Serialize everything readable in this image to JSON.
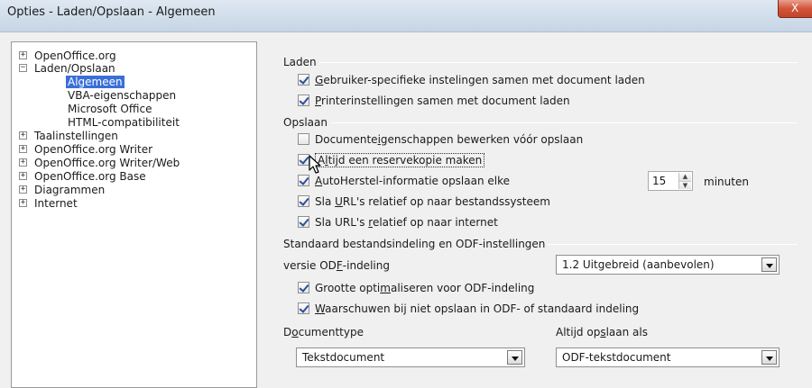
{
  "window": {
    "title": "Opties - Laden/Opslaan - Algemeen",
    "close_glyph": "X"
  },
  "tree": {
    "items": [
      {
        "label": "OpenOffice.org",
        "expander": "+"
      },
      {
        "label": "Laden/Opslaan",
        "expander": "−"
      },
      {
        "label": "Algemeen",
        "selected": true
      },
      {
        "label": "VBA-eigenschappen"
      },
      {
        "label": "Microsoft Office"
      },
      {
        "label": "HTML-compatibiliteit"
      },
      {
        "label": "Taalinstellingen",
        "expander": "+"
      },
      {
        "label": "OpenOffice.org Writer",
        "expander": "+"
      },
      {
        "label": "OpenOffice.org Writer/Web",
        "expander": "+"
      },
      {
        "label": "OpenOffice.org Base",
        "expander": "+"
      },
      {
        "label": "Diagrammen",
        "expander": "+"
      },
      {
        "label": "Internet",
        "expander": "+"
      }
    ]
  },
  "laden": {
    "title": "Laden",
    "options": [
      {
        "pre": "",
        "u": "G",
        "post": "ebruiker-specifieke instelingen samen met document laden",
        "checked": true
      },
      {
        "pre": "",
        "u": "P",
        "post": "rinterinstellingen samen met document laden",
        "checked": true
      }
    ]
  },
  "opslaan": {
    "title": "Opslaan",
    "options": [
      {
        "pre": "Documente",
        "u": "i",
        "post": "genschappen bewerken vóór opslaan",
        "checked": false
      },
      {
        "pre": "A",
        "u": "l",
        "post": "tijd een reservekopie maken",
        "checked": true
      },
      {
        "pre": "",
        "u": "A",
        "post": "utoHerstel-informatie opslaan elke",
        "checked": true
      },
      {
        "pre": "Sla ",
        "u": "U",
        "post": "RL's relatief op naar bestandssysteem",
        "checked": true
      },
      {
        "pre": "Sla URL's ",
        "u": "r",
        "post": "elatief op naar internet",
        "checked": true
      }
    ],
    "interval_value": "15",
    "interval_unit": "minuten"
  },
  "standaard": {
    "title": "Standaard bestandsindeling en ODF-instellingen",
    "odf_version_label_pre": "versie OD",
    "odf_version_label_u": "F",
    "odf_version_label_post": "-indeling",
    "odf_version_value": "1.2 Uitgebreid (aanbevolen)",
    "options": [
      {
        "pre": "Grootte opti",
        "u": "m",
        "post": "aliseren voor ODF-indeling",
        "checked": true
      },
      {
        "pre": "",
        "u": "W",
        "post": "aarschuwen bij niet opslaan in ODF- of standaard indeling",
        "checked": true
      }
    ],
    "doctype_label_pre": "D",
    "doctype_label_u": "o",
    "doctype_label_post": "cumenttype",
    "doctype_value": "Tekstdocument",
    "saveas_label_pre": "Altijd op",
    "saveas_label_u": "s",
    "saveas_label_post": "laan als",
    "saveas_value": "ODF-tekstdocument"
  },
  "icons": {
    "expand": "plus-box-icon",
    "collapse": "minus-box-icon",
    "dropdown": "chevron-down-icon",
    "cursor": "mouse-pointer-icon"
  }
}
